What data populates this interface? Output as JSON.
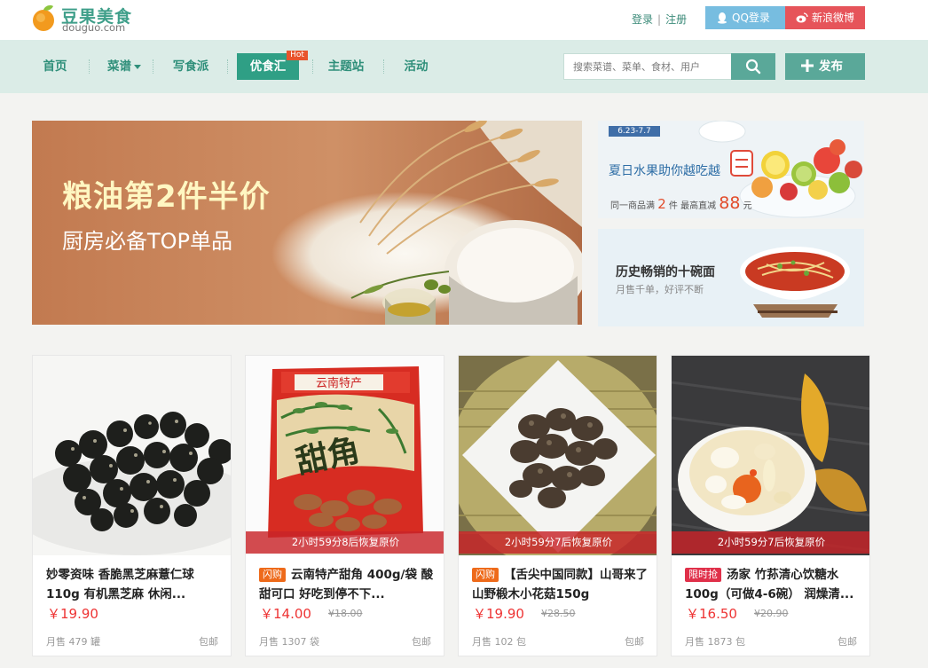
{
  "header": {
    "logo_cn": "豆果美食",
    "logo_en": "douguo.com",
    "login": "登录",
    "separator": "|",
    "register": "注册",
    "qq_login": "QQ登录",
    "weibo_login": "新浪微博"
  },
  "nav": {
    "items": [
      "首页",
      "菜谱",
      "写食派",
      "优食汇",
      "主题站",
      "活动"
    ],
    "active_index": 3,
    "hot_badge": "Hot",
    "search_placeholder": "搜索菜谱、菜单、食材、用户",
    "publish": "发布"
  },
  "banners": {
    "main_title": "粮油第2件半价",
    "main_subtitle": "厨房必备TOP单品",
    "side1_date": "6.23-7.7",
    "side1_title": "夏日水果助你越吃越",
    "side1_line_a": "同一商品满",
    "side1_line_b": "2",
    "side1_line_c": "件  最高直减",
    "side1_line_d": "88",
    "side1_line_e": "元",
    "side2_title": "历史畅销的十碗面",
    "side2_subtitle": "月售千单，好评不断"
  },
  "products": [
    {
      "title": "妙零资味 香脆黑芝麻薏仁球110g 有机黑芝麻 休闲...",
      "tag": "",
      "flash": "",
      "price": "￥19.90",
      "old_price": "",
      "sold": "月售 479 罐",
      "shipping": "包邮"
    },
    {
      "title": "云南特产甜角 400g/袋 酸甜可口 好吃到停不下...",
      "tag": "闪购",
      "flash": "2小时59分8后恢复原价",
      "price": "￥14.00",
      "old_price": "¥18.00",
      "sold": "月售 1307 袋",
      "shipping": "包邮"
    },
    {
      "title": "【舌尖中国同款】山哥来了 山野椴木小花菇150g",
      "tag": "闪购",
      "flash": "2小时59分7后恢复原价",
      "price": "￥19.90",
      "old_price": "¥28.50",
      "sold": "月售 102 包",
      "shipping": "包邮"
    },
    {
      "title": "汤家 竹荪清心饮糖水100g（可做4-6碗） 润燥清...",
      "tag": "限时抢",
      "flash": "2小时59分7后恢复原价",
      "price": "￥16.50",
      "old_price": "¥20.90",
      "sold": "月售 1873 包",
      "shipping": "包邮"
    }
  ],
  "colors": {
    "brand_green": "#2f9f85",
    "nav_bg": "#dbece7",
    "price_red": "#e33333",
    "qq_blue": "#77bde0",
    "weibo_red": "#e6545a"
  }
}
